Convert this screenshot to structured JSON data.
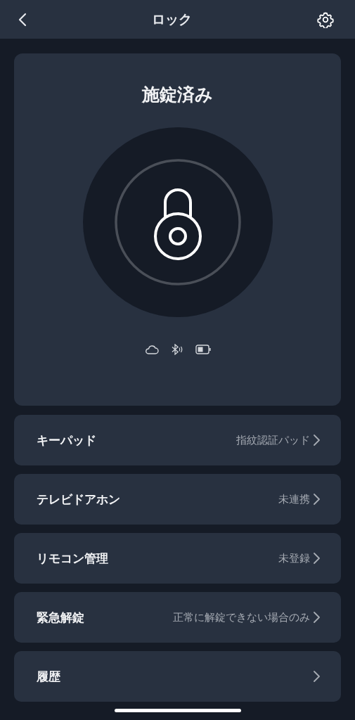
{
  "header": {
    "title": "ロック"
  },
  "lock": {
    "status": "施錠済み",
    "locked": true
  },
  "rows": [
    {
      "label": "キーパッド",
      "value": "指紋認証パッド"
    },
    {
      "label": "テレビドアホン",
      "value": "未連携"
    },
    {
      "label": "リモコン管理",
      "value": "未登録"
    },
    {
      "label": "緊急解錠",
      "value": "正常に解錠できない場合のみ"
    },
    {
      "label": "履歴"
    }
  ]
}
